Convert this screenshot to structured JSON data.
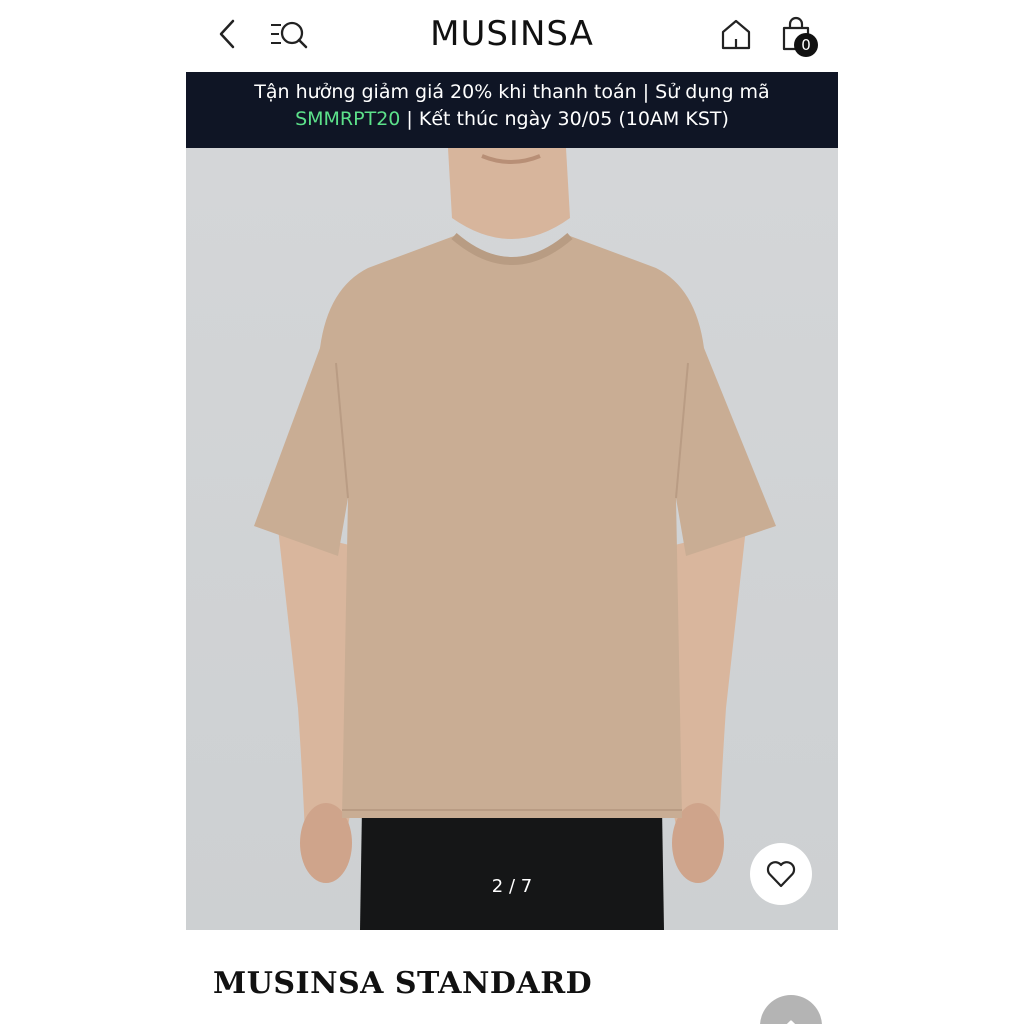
{
  "header": {
    "logo": "MUSINSA",
    "cart_count": "0",
    "icons": [
      "back-arrow-icon",
      "menu-search-icon",
      "home-icon",
      "shopping-bag-icon"
    ]
  },
  "banner": {
    "line1": "Tận hưởng giảm giá 20% khi thanh toán | Sử dụng mã",
    "code": "SMMRPT20",
    "line2_rest": " | Kết thúc ngày 30/05 (10AM KST)",
    "code_color": "#5ce18a",
    "background": "#0f1525"
  },
  "gallery": {
    "counter": "2 / 7",
    "current": 2,
    "total": 7
  },
  "product": {
    "brand": "MUSINSA STANDARD"
  }
}
